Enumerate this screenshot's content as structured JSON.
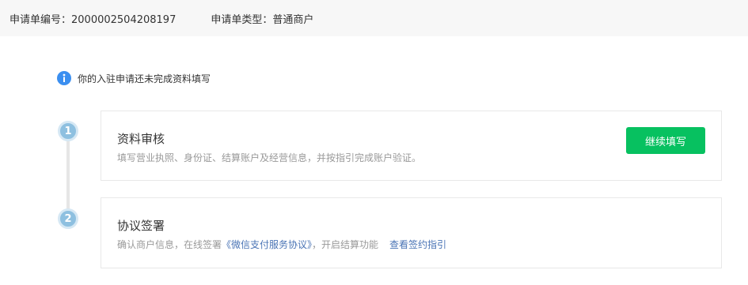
{
  "header": {
    "application_id_label": "申请单编号：2000002504208197",
    "application_type_label": "申请单类型：普通商户"
  },
  "notice": {
    "icon": "info-icon",
    "text": "你的入驻申请还未完成资料填写"
  },
  "steps": [
    {
      "number": "1",
      "title": "资料审核",
      "description": "填写营业执照、身份证、结算账户及经营信息，并按指引完成账户验证。",
      "button_label": "继续填写"
    },
    {
      "number": "2",
      "title": "协议签署",
      "description_prefix": "确认商户信息，在线签署",
      "agreement_link": "《微信支付服务协议》",
      "description_suffix": "，开启结算功能",
      "guide_link": "查看签约指引"
    }
  ],
  "colors": {
    "accent_green": "#07c160",
    "info_blue": "#3b8ff0",
    "link_blue": "#4a74b5",
    "step_circle": "#8ec0e0"
  }
}
